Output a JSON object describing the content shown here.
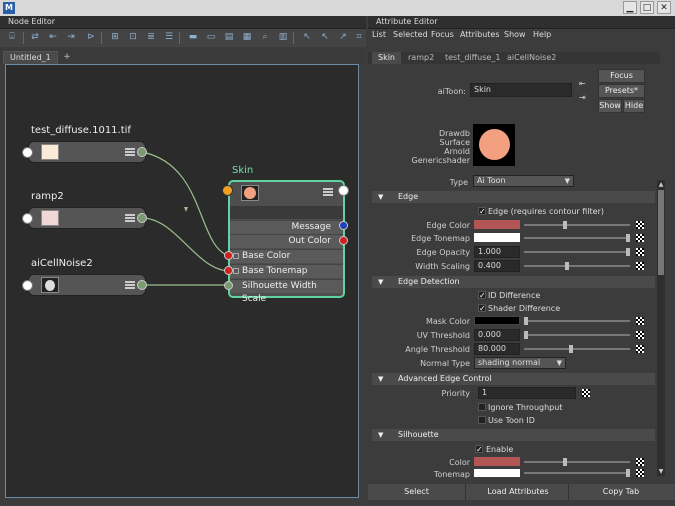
{
  "window": {
    "close_glyph": "✕"
  },
  "node_editor": {
    "panel_title": "Node Editor",
    "tabs": [
      "Untitled_1",
      "+"
    ],
    "nodes": {
      "test_diffuse": {
        "title": "test_diffuse.1011.tif",
        "swatch": "#f8ecd8"
      },
      "ramp2": {
        "title": "ramp2",
        "swatch": "#f0d6d6"
      },
      "aiCellNoise2": {
        "title": "aiCellNoise2",
        "swatch": "#dddddd"
      },
      "skin": {
        "title": "Skin",
        "swatch": "#f2a080",
        "outputs": [
          "Message",
          "Out Color"
        ],
        "inputs": [
          "Base Color",
          "Base Tonemap",
          "Silhouette Width Scale"
        ]
      }
    },
    "colors": {
      "connection": "#9bc08a",
      "selected_border": "#5fd3a0",
      "skin_title": "#6fe0a8"
    }
  },
  "attribute_editor": {
    "panel_title": "Attribute Editor",
    "menu": [
      "List",
      "Selected",
      "Focus",
      "Attributes",
      "Show",
      "Help"
    ],
    "tabs": [
      "Skin",
      "ramp2",
      "test_diffuse_1",
      "aiCellNoise2"
    ],
    "node_type_label": "aiToon:",
    "node_name": "Skin",
    "buttons": {
      "focus": "Focus",
      "presets": "Presets*",
      "show": "Show",
      "hide": "Hide"
    },
    "swatch_labels": [
      "Drawdb",
      "Surface",
      "Arnold",
      "Genericshader"
    ],
    "type_label": "Type",
    "type_value": "Ai Toon",
    "sections": {
      "edge": {
        "title": "Edge",
        "checkbox": "Edge (requires contour filter)",
        "edge_color_label": "Edge Color",
        "edge_color": "#b45555",
        "edge_tonemap_label": "Edge Tonemap",
        "edge_opacity_label": "Edge Opacity",
        "edge_opacity": "1.000",
        "width_scaling_label": "Width Scaling",
        "width_scaling": "0.400"
      },
      "edge_detection": {
        "title": "Edge Detection",
        "id_difference": "ID Difference",
        "shader_difference": "Shader Difference",
        "mask_color_label": "Mask Color",
        "uv_threshold_label": "UV Threshold",
        "uv_threshold": "0.000",
        "angle_threshold_label": "Angle Threshold",
        "angle_threshold": "80.000",
        "normal_type_label": "Normal Type",
        "normal_type": "shading normal"
      },
      "advanced": {
        "title": "Advanced Edge Control",
        "priority_label": "Priority",
        "priority": "1",
        "ignore_throughput": "Ignore Throughput",
        "use_toon_id": "Use Toon ID"
      },
      "silhouette": {
        "title": "Silhouette",
        "enable": "Enable",
        "color_label": "Color",
        "color": "#b45555",
        "tonemap_label": "Tonemap"
      }
    },
    "bottom_buttons": [
      "Select",
      "Load Attributes",
      "Copy Tab"
    ]
  }
}
